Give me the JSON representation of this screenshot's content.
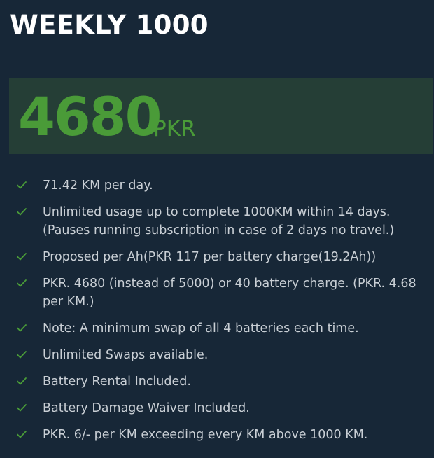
{
  "plan": {
    "title": "WEEKLY 1000",
    "price": "4680",
    "currency": "PKR"
  },
  "features": [
    "71.42 KM per day.",
    "Unlimited usage up to complete 1000KM within 14 days. (Pauses running subscription in case of 2 days no travel.)",
    "Proposed per Ah(PKR 117 per battery charge(19.2Ah))",
    "PKR. 4680 (instead of 5000) or 40 battery charge. (PKR. 4.68 per KM.)",
    "Note: A minimum swap of all 4 batteries each time.",
    "Unlimited Swaps available.",
    "Battery Rental Included.",
    "Battery Damage Waiver Included.",
    "PKR. 6/- per KM exceeding every KM above 1000 KM."
  ],
  "icons": {
    "feature_marker": "check-icon"
  },
  "colors": {
    "background": "#172737",
    "price_band": "#253e36",
    "accent_green": "#4a9b38",
    "title": "#ffffff",
    "body_text": "#c9cfd5"
  }
}
